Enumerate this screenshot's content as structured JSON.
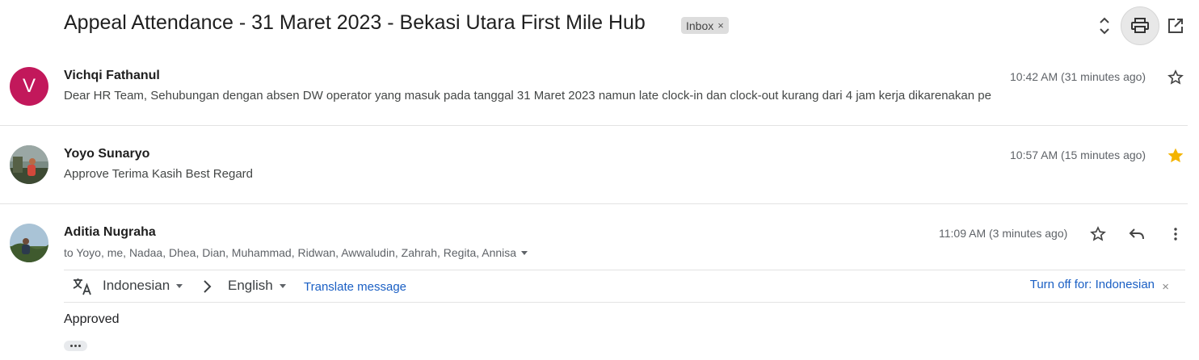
{
  "subject": "Appeal Attendance - 31 Maret 2023 - Bekasi Utara First Mile Hub",
  "label_chip": {
    "text": "Inbox",
    "close": "×"
  },
  "toolbar": {
    "expand_icon": "unfold-icon",
    "print_icon": "print-icon",
    "popout_icon": "open-in-new-window-icon"
  },
  "messages": [
    {
      "sender": "Vichqi Fathanul",
      "avatar_letter": "V",
      "avatar_color": "#c2185b",
      "time": "10:42 AM (31 minutes ago)",
      "snippet": "Dear HR Team, Sehubungan dengan absen DW operator yang masuk pada tanggal 31 Maret 2023 namun late clock-in dan clock-out kurang dari 4 jam kerja dikarenakan pe",
      "starred": false
    },
    {
      "sender": "Yoyo Sunaryo",
      "avatar": "photo-avatar",
      "time": "10:57 AM (15 minutes ago)",
      "snippet": "Approve Terima Kasih Best Regard",
      "starred": true,
      "star_color": "#f4b400"
    },
    {
      "sender": "Aditia Nugraha",
      "avatar": "photo-avatar",
      "time": "11:09 AM (3 minutes ago)",
      "recipients": "to Yoyo, me, Nadaa, Dhea, Dian, Muhammad, Ridwan, Awwaludin, Zahrah, Regita, Annisa",
      "body": "Approved",
      "starred": false
    }
  ],
  "translate": {
    "from_lang": "Indonesian",
    "to_lang": "English",
    "link": "Translate message",
    "turn_off": "Turn off for: Indonesian",
    "close": "×"
  },
  "colors": {
    "accent": "#1a5fc4",
    "avatar_v": "#c2185b",
    "star_filled": "#f4b400"
  }
}
